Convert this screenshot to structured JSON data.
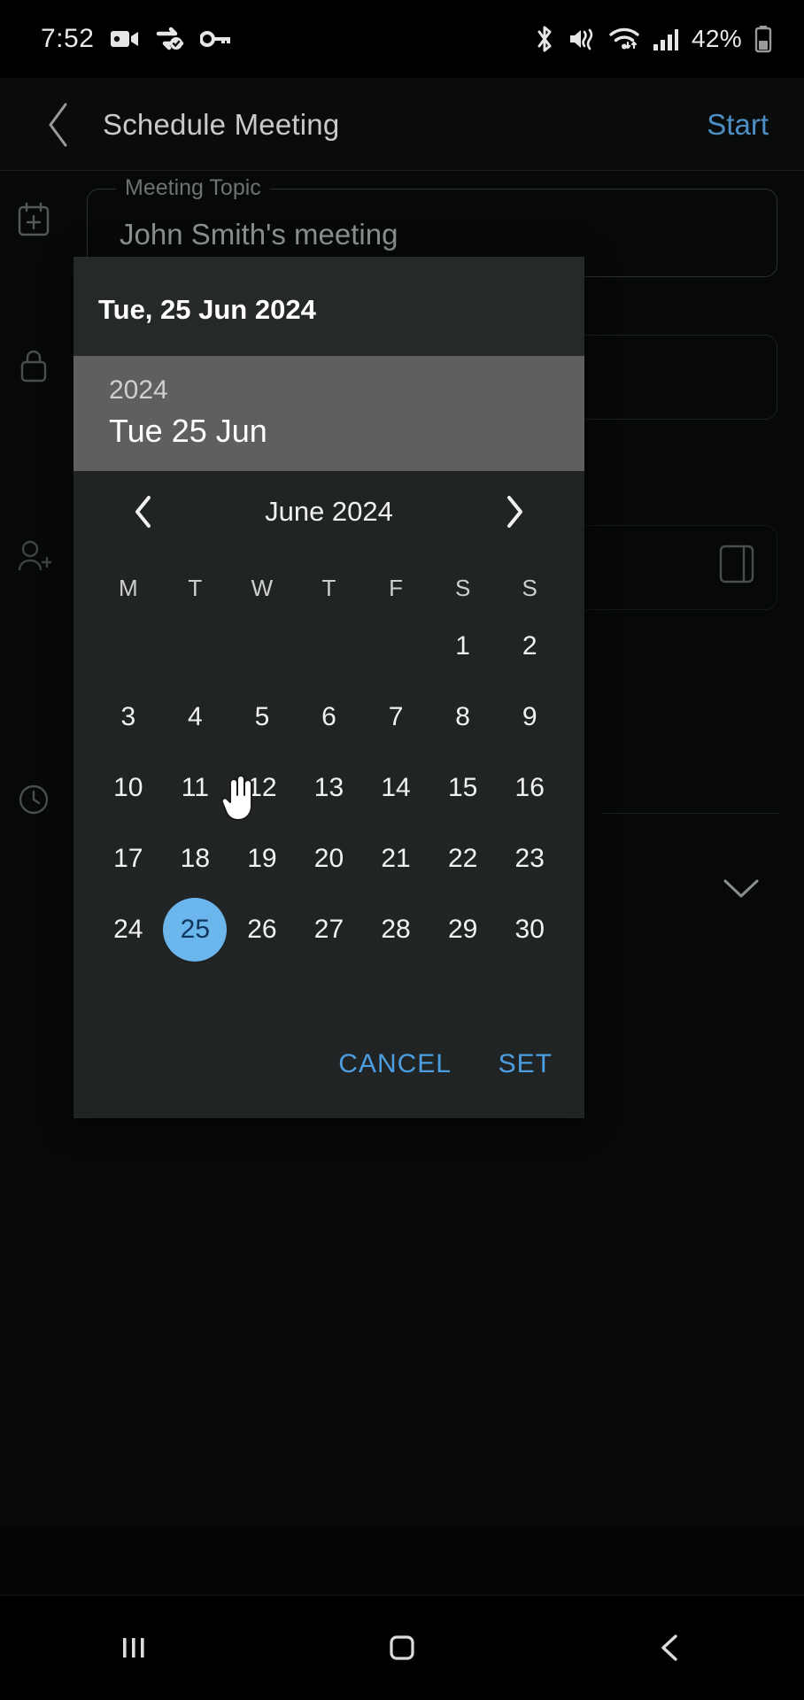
{
  "statusbar": {
    "time": "7:52",
    "battery_percent": "42%",
    "left_icons": [
      "video-camera-icon",
      "sync-check-icon",
      "vpn-key-icon"
    ],
    "right_icons": [
      "bluetooth-icon",
      "mute-vibrate-icon",
      "wifi-icon",
      "signal-bars-icon",
      "battery-icon"
    ]
  },
  "appbar": {
    "back_icon": "chevron-left-icon",
    "title": "Schedule Meeting",
    "action": "Start",
    "accent": "#4d8fc4"
  },
  "form": {
    "topic": {
      "icon": "calendar-add-icon",
      "label": "Meeting Topic",
      "value": "John Smith's meeting"
    },
    "rows": [
      {
        "icon": "lock-icon"
      },
      {
        "icon": "person-add-icon"
      },
      {
        "icon": "clock-icon"
      }
    ],
    "side_icon": "sidebar-panel-icon",
    "expand_icon": "chevron-down-icon"
  },
  "dialog": {
    "header_date": "Tue, 25 Jun 2024",
    "band_year": "2024",
    "band_date": "Tue 25 Jun",
    "nav": {
      "prev_icon": "chevron-left-icon",
      "next_icon": "chevron-right-icon",
      "month_title": "June 2024"
    },
    "weekdays": [
      "M",
      "T",
      "W",
      "T",
      "F",
      "S",
      "S"
    ],
    "weeks": [
      [
        "",
        "",
        "",
        "",
        "",
        "1",
        "2"
      ],
      [
        "3",
        "4",
        "5",
        "6",
        "7",
        "8",
        "9"
      ],
      [
        "10",
        "11",
        "12",
        "13",
        "14",
        "15",
        "16"
      ],
      [
        "17",
        "18",
        "19",
        "20",
        "21",
        "22",
        "23"
      ],
      [
        "24",
        "25",
        "26",
        "27",
        "28",
        "29",
        "30"
      ]
    ],
    "selected_day": "25",
    "selected_color": "#6cb6ee",
    "cancel_label": "CANCEL",
    "set_label": "SET",
    "action_color": "#4d9ee0"
  },
  "navbar": {
    "recents_icon": "recents-icon",
    "home_icon": "home-icon",
    "back_icon": "back-icon"
  },
  "cursor": {
    "icon": "pointer-hand-cursor"
  }
}
